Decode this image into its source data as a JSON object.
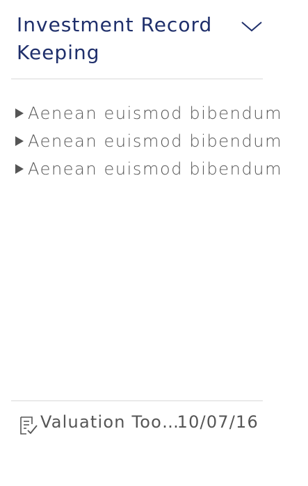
{
  "card": {
    "title": "Investment Record Keeping",
    "collapse_icon": "chevron-down-icon",
    "items": [
      {
        "label": "Aenean euismod bibendum",
        "icon": "caret-right-icon"
      },
      {
        "label": "Aenean euismod bibendum",
        "icon": "caret-right-icon"
      },
      {
        "label": "Aenean euismod bibendum",
        "icon": "caret-right-icon"
      }
    ],
    "footer": {
      "icon": "document-check-icon",
      "doc_name": "Valuation Tool...",
      "date": "10/07/16"
    }
  },
  "colors": {
    "title": "#1f2f6b",
    "text": "#555555",
    "divider": "#d9d9d9",
    "background": "#ffffff"
  }
}
